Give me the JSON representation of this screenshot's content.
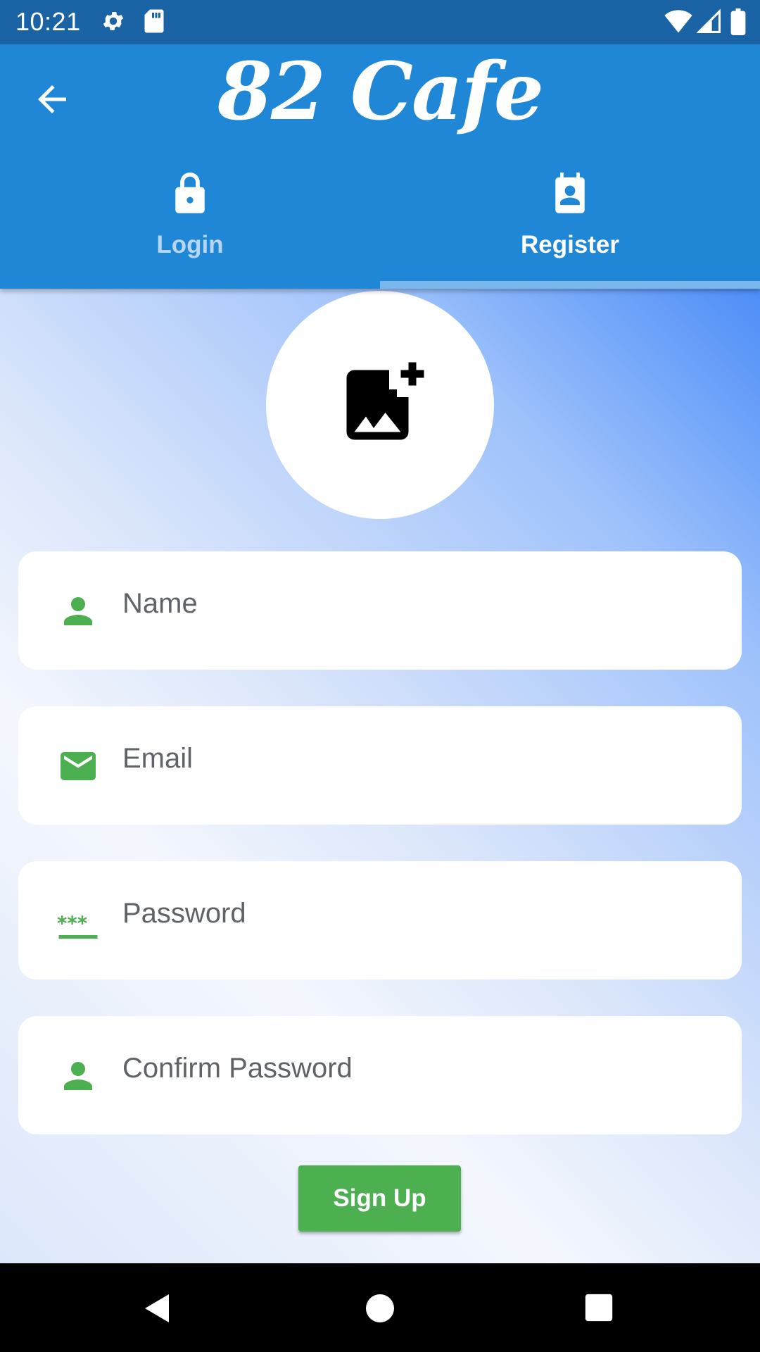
{
  "status_bar": {
    "time": "10:21",
    "icons": [
      "gear-icon",
      "sd-card-icon",
      "wifi-icon",
      "signal-icon",
      "battery-icon"
    ]
  },
  "app_bar": {
    "title": "82 Cafe",
    "back_icon": "arrow-left-icon",
    "tabs": [
      {
        "label": "Login",
        "icon": "lock-icon",
        "selected": false
      },
      {
        "label": "Register",
        "icon": "contact-badge-icon",
        "selected": true
      }
    ]
  },
  "form": {
    "avatar_icon": "add-photo-icon",
    "fields": [
      {
        "placeholder": "Name",
        "icon": "person-icon"
      },
      {
        "placeholder": "Email",
        "icon": "mail-icon"
      },
      {
        "placeholder": "Password",
        "icon": "password-icon"
      },
      {
        "placeholder": "Confirm Password",
        "icon": "person-icon"
      }
    ],
    "submit_label": "Sign Up"
  },
  "nav_bar": {
    "icons": [
      "back-triangle-icon",
      "home-circle-icon",
      "recents-square-icon"
    ]
  },
  "colors": {
    "status_bar": "#1a64a6",
    "app_bar": "#1f87d6",
    "tab_indicator": "#7ab7ec",
    "accent_green": "#4caf50",
    "gradient_top_right": "#4d8ef8"
  }
}
